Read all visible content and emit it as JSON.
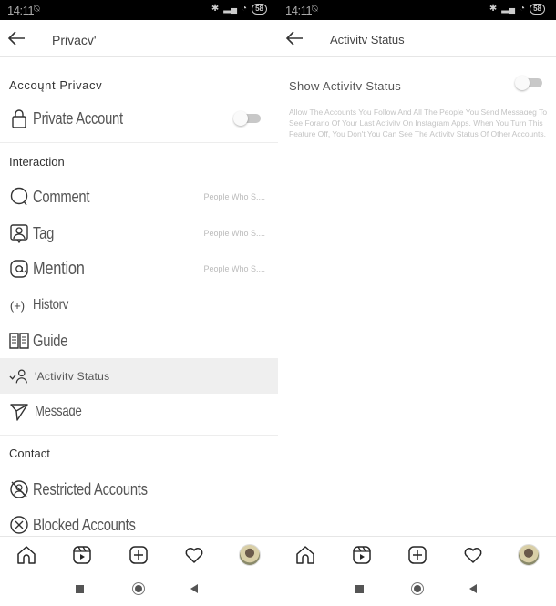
{
  "status_bar": {
    "time": "14:11",
    "alarm_icon": "alarm-off-icon",
    "icons": [
      "bluetooth-icon",
      "signal-icon",
      "wifi-icon"
    ],
    "battery": "58"
  },
  "left_screen": {
    "header": {
      "title": "Privacv'",
      "back_icon": "arrow-left-icon"
    },
    "sections": {
      "account_privacy": "Accoųnt Privacv",
      "interaction": "Interaction",
      "contact": "Contact"
    },
    "private_account": {
      "label": "Private Account",
      "icon": "lock-icon",
      "toggle_on": false
    },
    "interaction_items": [
      {
        "label": "Comment",
        "icon": "comment-icon",
        "value": "People Who S...."
      },
      {
        "label": "Tag",
        "icon": "tag-person-icon",
        "value": "People Who S...."
      },
      {
        "label": "Mention",
        "icon": "at-icon",
        "value": "People Who S...."
      },
      {
        "label": "Historv",
        "icon": "story-add-icon",
        "value": ""
      },
      {
        "label": "Guide",
        "icon": "guide-book-icon",
        "value": ""
      },
      {
        "label": "'Activitv Status",
        "icon": "activity-status-icon",
        "value": ""
      },
      {
        "label": "Messaɑe",
        "icon": "send-icon",
        "value": ""
      }
    ],
    "contact_items": [
      {
        "label": "Restricted Accounts",
        "icon": "restricted-icon"
      },
      {
        "label": "Blocked Accounts",
        "icon": "blocked-icon"
      }
    ]
  },
  "right_screen": {
    "header": {
      "title": "Activitv Status",
      "back_icon": "arrow-left-icon"
    },
    "show_activity": {
      "label": "Show Activitv Status",
      "toggle_on": false,
      "description": "Allow The Accounts You Follow And All The People You Send Messaɑeɡ To See Forario Of Your Last Activitv On Instagram Apps. When You Turn This Feature Off, You Don't You Can See The Activitv Status Of Other Accounts."
    }
  },
  "tab_bar": {
    "items": [
      "home-icon",
      "reels-icon",
      "new-post-icon",
      "activity-heart-icon",
      "profile-avatar"
    ]
  },
  "nav_bar": {
    "items": [
      "recents-button",
      "home-button",
      "back-button"
    ]
  }
}
